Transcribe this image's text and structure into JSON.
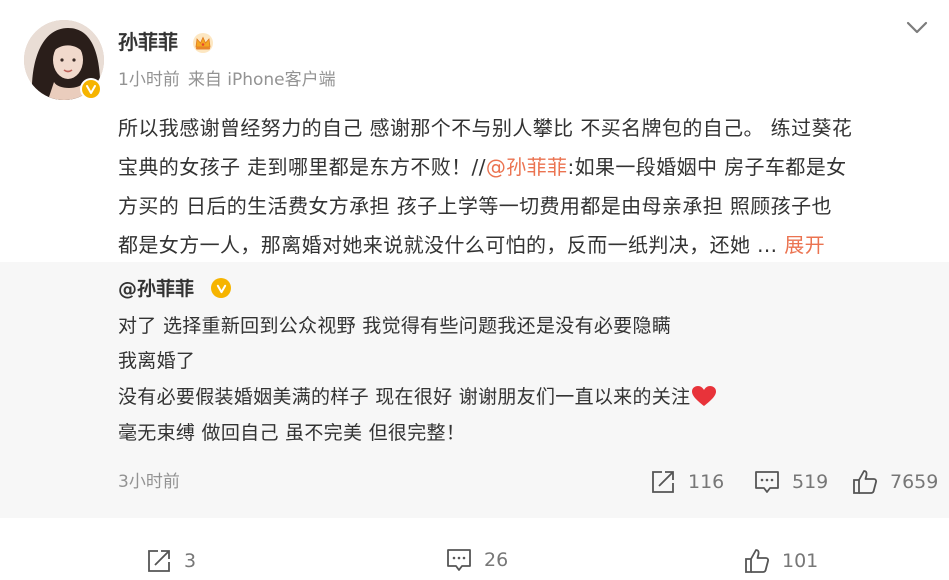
{
  "post": {
    "author": "孙菲菲",
    "time": "1小时前",
    "source": "来自 iPhone客户端",
    "lines": [
      "所以我感谢曾经努力的自己 感谢那个不与别人攀比 不买名牌包的自己。 练过葵花",
      "宝典的女孩子 走到哪里都是东方不败！//",
      "方买的 日后的生活费女方承担  孩子上学等一切费用都是由母亲承担  照顾孩子也",
      "都是女方一人，那离婚对她来说就没什么可怕的，反而一纸判决，还她 ... "
    ],
    "mention": "@孙菲菲",
    "line2_rest": ":如果一段婚姻中 房子车都是女",
    "expand_label": "展开"
  },
  "quoted": {
    "author": "@孙菲菲",
    "lines": [
      "对了 选择重新回到公众视野 我觉得有些问题我还是没有必要隐瞒",
      "我离婚了",
      "没有必要假装婚姻美满的样子 现在很好 谢谢朋友们一直以来的关注",
      "毫无束缚 做回自己 虽不完美 但很完整！"
    ],
    "time": "3小时前",
    "reposts": "116",
    "comments": "519",
    "likes": "7659"
  },
  "actions": {
    "reposts": "3",
    "comments": "26",
    "likes": "101"
  },
  "colors": {
    "accent": "#eb7350",
    "verified": "#f6b400",
    "heart": "#e8333a"
  },
  "icons": [
    "avatar",
    "verified-badge-icon",
    "crown-icon",
    "chevron-down-icon",
    "heart-icon",
    "repost-icon",
    "comment-icon",
    "like-icon"
  ]
}
